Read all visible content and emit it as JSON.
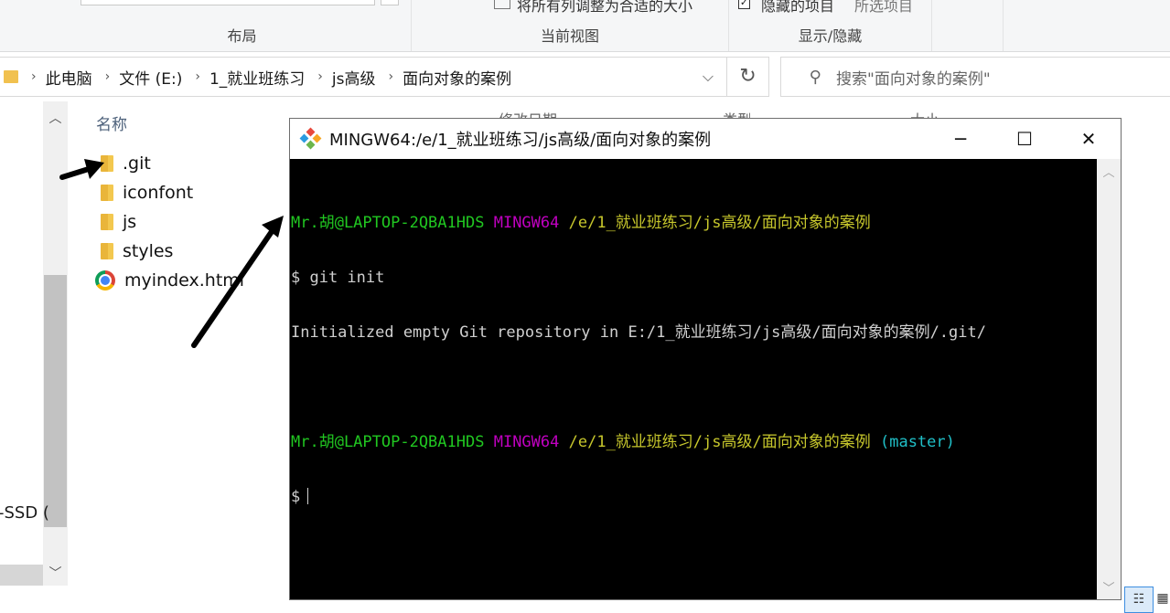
{
  "ribbon": {
    "group_layout": "布局",
    "group_current_view": "当前视图",
    "group_show_hide": "显示/隐藏",
    "fit_columns": "将所有列调整为合适的大小",
    "hidden_items": "隐藏的项目",
    "selected_items": "所选项目"
  },
  "address": {
    "crumbs": [
      "此电脑",
      "文件 (E:)",
      "1_就业班练习",
      "js高级",
      "面向对象的案例"
    ],
    "dropdown_icon": "chevron-down-icon",
    "refresh_icon": "refresh-icon"
  },
  "search": {
    "placeholder": "搜索\"面向对象的案例\"",
    "icon": "search-icon"
  },
  "nav": {
    "drive_fragment": "-SSD ("
  },
  "file_list": {
    "column_name": "名称",
    "files": [
      {
        "name": ".git",
        "icon": "folder-icon"
      },
      {
        "name": "iconfont",
        "icon": "folder-icon"
      },
      {
        "name": "js",
        "icon": "folder-icon"
      },
      {
        "name": "styles",
        "icon": "folder-icon"
      },
      {
        "name": "myindex.html",
        "icon": "chrome-icon"
      }
    ]
  },
  "terminal": {
    "title": "MINGW64:/e/1_就业班练习/js高级/面向对象的案例",
    "prompt1": {
      "user": "Mr.胡@LAPTOP-2QBA1HDS",
      "env": "MINGW64",
      "path": "/e/1_就业班练习/js高级/面向对象的案例"
    },
    "command": "$ git init",
    "output": "Initialized empty Git repository in E:/1_就业班练习/js高级/面向对象的案例/.git/",
    "prompt2": {
      "user": "Mr.胡@LAPTOP-2QBA1HDS",
      "env": "MINGW64",
      "path": "/e/1_就业班练习/js高级/面向对象的案例",
      "branch": "(master)"
    },
    "input_prompt": "$"
  },
  "colors": {
    "green": "#21c721",
    "magenta": "#c000c0",
    "yellow": "#c7c72c",
    "cyan": "#20c0c8",
    "folder": "#f3c84f"
  }
}
